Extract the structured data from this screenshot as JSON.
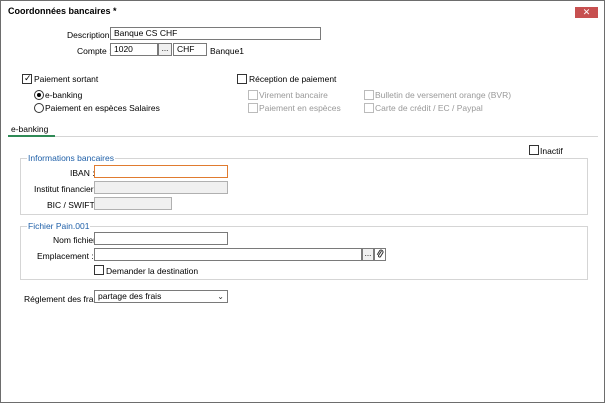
{
  "window": {
    "title": "Coordonnées bancaires *",
    "close_label": "✕"
  },
  "description": {
    "label": "Description :",
    "value": "Banque CS CHF"
  },
  "compte": {
    "label": "Compte :",
    "number": "1020",
    "browse_label": "...",
    "currency": "CHF",
    "name": "Banque1"
  },
  "paiement_sortant": {
    "label": "Paiement sortant",
    "checked": true,
    "options": [
      {
        "label": "e-banking",
        "selected": true
      },
      {
        "label": "Paiement en espèces Salaires",
        "selected": false
      }
    ]
  },
  "reception": {
    "label": "Réception de paiement",
    "checked": false,
    "options": [
      "Virement bancaire",
      "Paiement en espèces",
      "Bulletin de versement orange (BVR)",
      "Carte de crédit / EC / Paypal"
    ]
  },
  "tabs": [
    {
      "label": "e-banking"
    }
  ],
  "inactif": {
    "label": "Inactif",
    "checked": false
  },
  "infos": {
    "title": "Informations bancaires",
    "iban_label": "IBAN :",
    "iban_value": "",
    "institut_label": "Institut financier :",
    "bic_label": "BIC / SWIFT :"
  },
  "pain": {
    "title": "Fichier Pain.001",
    "nom_label": "Nom fichier :",
    "nom_value": "",
    "emplacement_label": "Emplacement :",
    "browse_label": "...",
    "demander_label": "Demander la destination"
  },
  "reglement": {
    "label": "Réglement des frais :",
    "value": "partage des frais"
  }
}
